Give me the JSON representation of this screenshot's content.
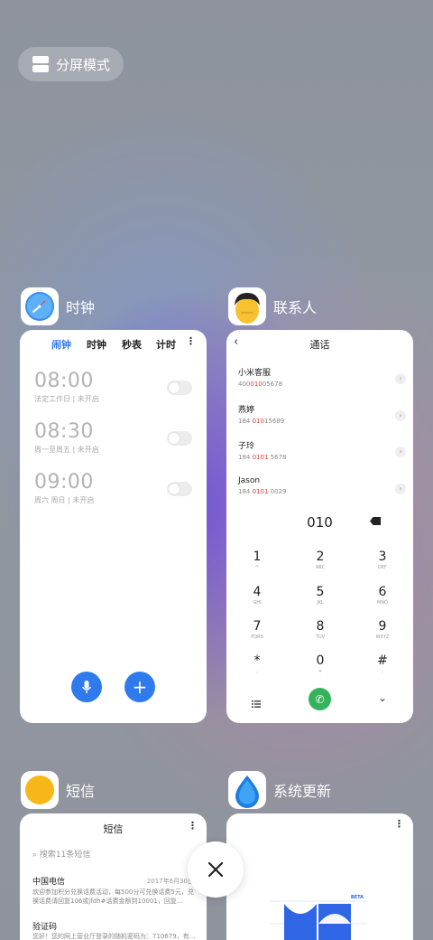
{
  "split_mode": {
    "label": "分屏模式"
  },
  "apps": {
    "clock": {
      "name": "时钟",
      "tabs": [
        "闹钟",
        "时钟",
        "秒表",
        "计时"
      ],
      "active_tab_color": "#2f7bee",
      "alarms": [
        {
          "time": "08:00",
          "sub": "法定工作日 | 未开启"
        },
        {
          "time": "08:30",
          "sub": "周一至周五 | 未开启"
        },
        {
          "time": "09:00",
          "sub": "周六 周日 | 未开启"
        }
      ]
    },
    "contacts": {
      "name": "联系人",
      "title": "通话",
      "entries": [
        {
          "name": "小米客服",
          "num_pre": "400",
          "num_hl": "010",
          "num_post": "05678"
        },
        {
          "name": "燕婷",
          "num_pre": "184 ",
          "num_hl": "010",
          "num_post": "15689"
        },
        {
          "name": "子玲",
          "num_pre": "184 ",
          "num_hl": "0101",
          "num_post": " 5678"
        },
        {
          "name": "Jason",
          "num_pre": "184 ",
          "num_hl": "0101",
          "num_post": " 0029"
        }
      ],
      "dial_input": "010",
      "keys": [
        {
          "d": "1",
          "l": "ꟹ"
        },
        {
          "d": "2",
          "l": "ABC"
        },
        {
          "d": "3",
          "l": "DEF"
        },
        {
          "d": "4",
          "l": "GHI"
        },
        {
          "d": "5",
          "l": "JKL"
        },
        {
          "d": "6",
          "l": "MNO"
        },
        {
          "d": "7",
          "l": "PQRS"
        },
        {
          "d": "8",
          "l": "TUV"
        },
        {
          "d": "9",
          "l": "WXYZ"
        },
        {
          "d": "*",
          "l": ","
        },
        {
          "d": "0",
          "l": "+"
        },
        {
          "d": "#",
          "l": ";"
        }
      ],
      "call_color": "#34b25c"
    },
    "sms": {
      "name": "短信",
      "title": "短信",
      "search_placeholder": "搜索11条短信",
      "messages": [
        {
          "title": "中国电信",
          "date": "2017年6月30日",
          "text": "欢迎参加积分兑换话费活动，每500分可兑换话费5元，兑换话费请回复106或jfdh#话费金额到10001，回复…"
        },
        {
          "title": "验证码",
          "date": "",
          "text": "您好！您的网上营业厅登录的随机密码为：710679，有…"
        }
      ]
    },
    "updater": {
      "name": "系统更新",
      "badge": "BETA"
    }
  }
}
